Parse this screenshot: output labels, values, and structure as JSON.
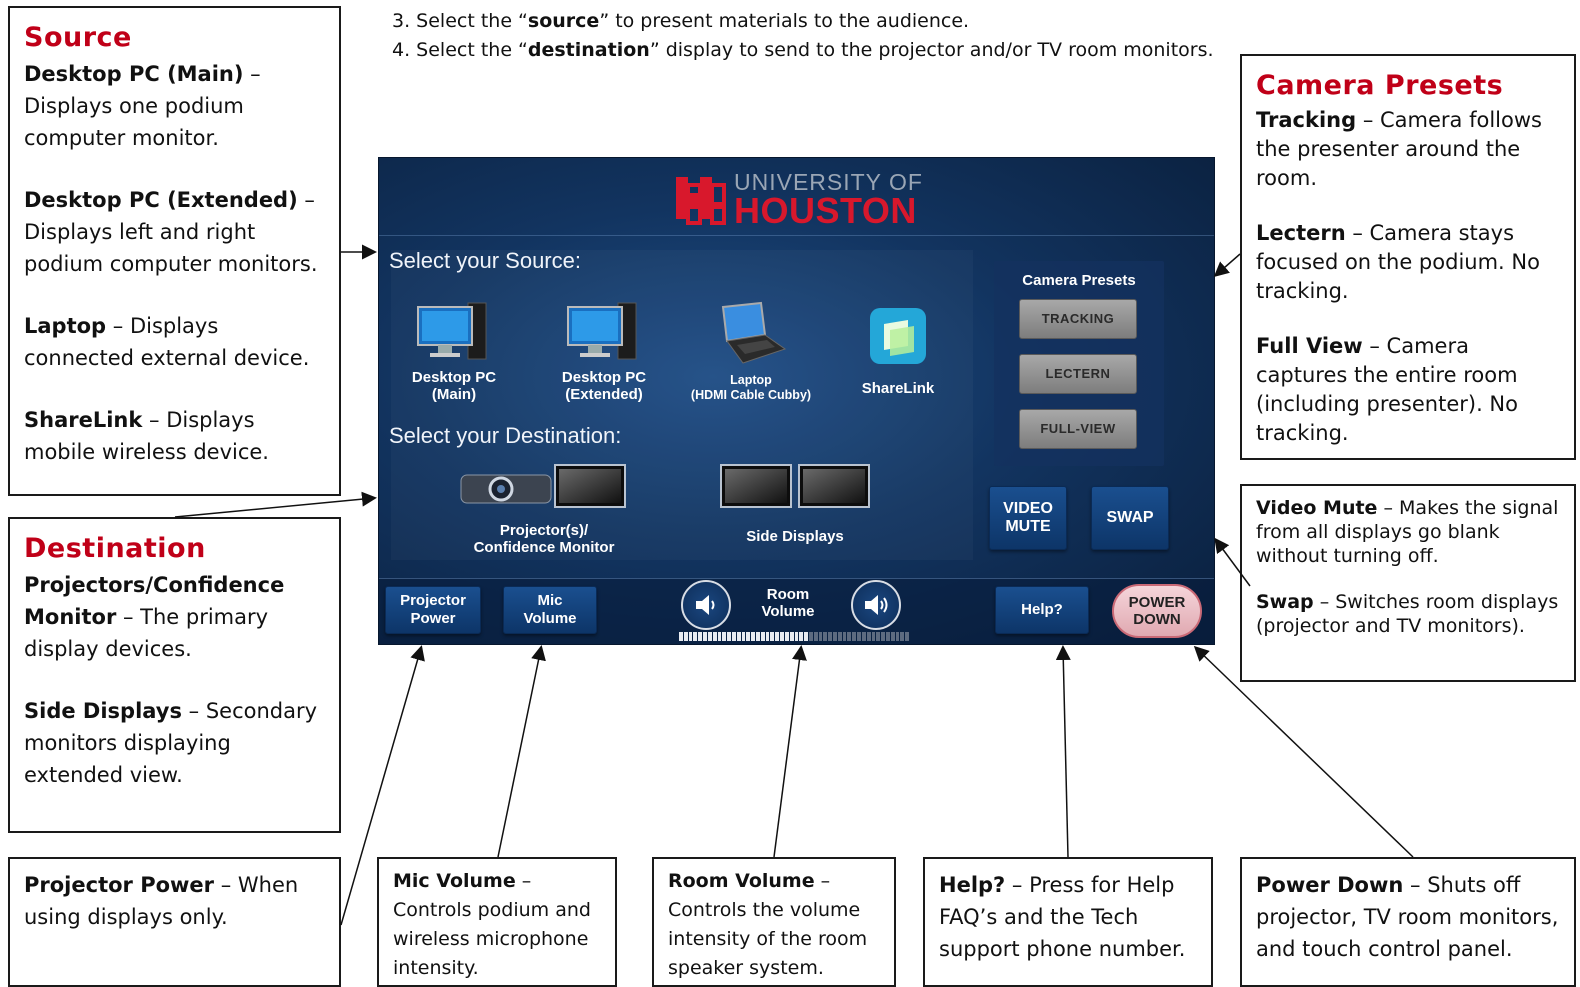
{
  "instructions": [
    "3. Select the “",
    "source",
    "” to present materials to the audience.",
    "4. Select the “",
    "destination",
    "” display to send to the projector and/or TV room monitors."
  ],
  "source_box": {
    "heading": "Source",
    "items": [
      {
        "term": "Desktop PC (Main)",
        "desc": " – Displays one podium computer monitor."
      },
      {
        "term": "Desktop PC (Extended)",
        "desc": " – Displays left and right podium computer monitors."
      },
      {
        "term": "Laptop",
        "desc": " – Displays connected external device."
      },
      {
        "term": "ShareLink",
        "desc": " – Displays mobile wireless device."
      }
    ]
  },
  "destination_box": {
    "heading": "Destination",
    "items": [
      {
        "term": "Projectors/Confidence Monitor",
        "desc": " – The primary display devices."
      },
      {
        "term": "Side Displays",
        "desc": " – Secondary monitors displaying extended view."
      }
    ]
  },
  "camera_box": {
    "heading": "Camera Presets",
    "items": [
      {
        "term": "Tracking",
        "desc": " – Camera follows the presenter around the room."
      },
      {
        "term": "Lectern",
        "desc": " – Camera stays focused on the podium. No tracking."
      },
      {
        "term": "Full View",
        "desc": " – Camera captures the entire room (including presenter). No tracking."
      }
    ]
  },
  "video_box": {
    "items": [
      {
        "term": "Video Mute",
        "desc": " – Makes the signal from all displays go blank without turning off."
      },
      {
        "term": "Swap",
        "desc": " – Switches room displays (projector and TV monitors)."
      }
    ]
  },
  "bottom_boxes": [
    {
      "term": "Projector Power",
      "desc": " – When using displays only."
    },
    {
      "term": "Mic Volume",
      "desc": " – Controls podium and wireless microphone intensity."
    },
    {
      "term": "Room Volume",
      "desc": " – Controls the volume intensity of the room speaker system."
    },
    {
      "term": "Help?",
      "desc": " – Press for Help FAQ’s and the Tech support phone number."
    },
    {
      "term": "Power Down",
      "desc": " – Shuts off projector, TV room monitors, and touch control panel."
    }
  ],
  "panel": {
    "logo_line1": "UNIVERSITY OF",
    "logo_line2": "HOUSTON",
    "select_source": "Select your Source:",
    "select_destination": "Select your Destination:",
    "sources": [
      {
        "line1": "Desktop PC",
        "line2": "(Main)",
        "icon": "desktop-pc-icon"
      },
      {
        "line1": "Desktop PC",
        "line2": "(Extended)",
        "icon": "desktop-pc-icon"
      },
      {
        "line1": "Laptop",
        "line2": "(HDMI Cable Cubby)",
        "icon": "laptop-icon"
      },
      {
        "line1": "ShareLink",
        "line2": "",
        "icon": "sharelink-icon"
      }
    ],
    "destinations": [
      {
        "line1": "Projector(s)/",
        "line2": "Confidence Monitor",
        "icon": "projector-icon"
      },
      {
        "line1": "Side Displays",
        "line2": "",
        "icon": "tv-monitor-icon"
      }
    ],
    "camera_title": "Camera Presets",
    "camera_buttons": [
      "TRACKING",
      "LECTERN",
      "FULL-VIEW"
    ],
    "video_mute": [
      "VIDEO",
      "MUTE"
    ],
    "swap": "SWAP",
    "projector_power": [
      "Projector",
      "Power"
    ],
    "mic_volume": [
      "Mic",
      "Volume"
    ],
    "room_volume": [
      "Room",
      "Volume"
    ],
    "room_volume_level": 0.55,
    "help": "Help?",
    "power_down": [
      "POWER",
      "DOWN"
    ],
    "colors": {
      "accent_red": "#c00018",
      "panel_blue": "#123460",
      "power_pink": "#e8b9c0"
    }
  }
}
